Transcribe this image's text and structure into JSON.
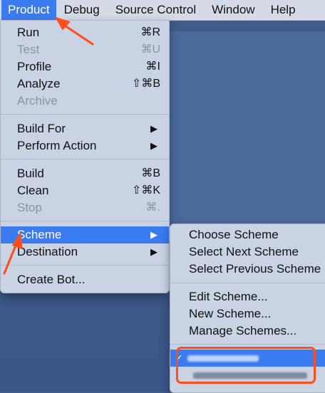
{
  "menubar": {
    "items": [
      "Product",
      "Debug",
      "Source Control",
      "Window",
      "Help"
    ],
    "active": "Product"
  },
  "product_menu": {
    "run": {
      "label": "Run",
      "shortcut": "⌘R"
    },
    "test": {
      "label": "Test",
      "shortcut": "⌘U"
    },
    "profile": {
      "label": "Profile",
      "shortcut": "⌘I"
    },
    "analyze": {
      "label": "Analyze",
      "shortcut": "⇧⌘B"
    },
    "archive": {
      "label": "Archive"
    },
    "build_for": {
      "label": "Build For"
    },
    "perform_action": {
      "label": "Perform Action"
    },
    "build": {
      "label": "Build",
      "shortcut": "⌘B"
    },
    "clean": {
      "label": "Clean",
      "shortcut": "⇧⌘K"
    },
    "stop": {
      "label": "Stop",
      "shortcut": "⌘."
    },
    "scheme": {
      "label": "Scheme"
    },
    "destination": {
      "label": "Destination"
    },
    "create_bot": {
      "label": "Create Bot..."
    }
  },
  "scheme_menu": {
    "choose": "Choose Scheme",
    "select_next": "Select Next Scheme",
    "select_previous": "Select Previous Scheme",
    "edit": "Edit Scheme...",
    "new": "New Scheme...",
    "manage": "Manage Schemes..."
  },
  "icons": {
    "submenu": "▶",
    "check": "✓"
  },
  "colors": {
    "highlight": "#3a7cf0",
    "annotation": "#ff4d1c",
    "menu_bg": "#c9d3e3",
    "disabled_text": "#8a93a3"
  }
}
